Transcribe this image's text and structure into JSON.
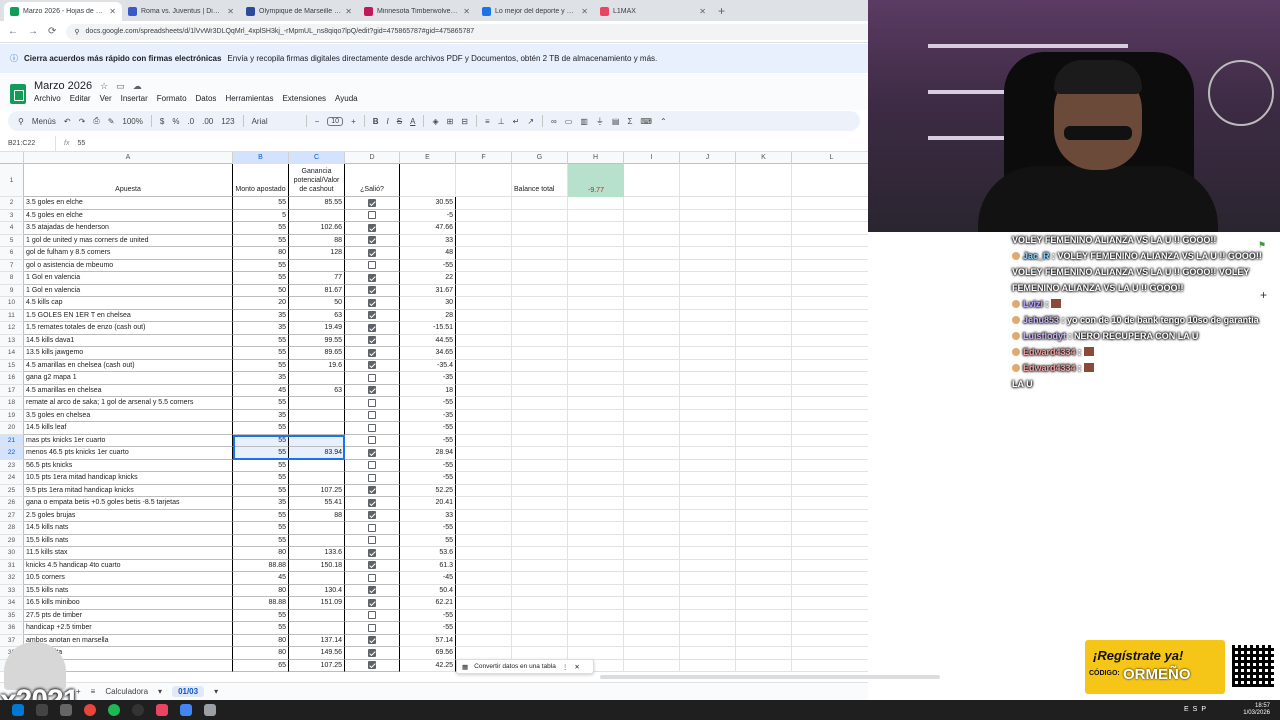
{
  "browser": {
    "tabs": [
      {
        "title": "Marzo 2026 - Hojas de cálculo",
        "color": "#0f9d58"
      },
      {
        "title": "Roma vs. Juventus | Disney+",
        "color": "#3a5bc7"
      },
      {
        "title": "Olympique de Marseille - Olym",
        "color": "#2b4a9a"
      },
      {
        "title": "Minnesota Timberwolves vs Det",
        "color": "#c2185b"
      },
      {
        "title": "Lo mejor del deporte y el entre",
        "color": "#1a73e8"
      },
      {
        "title": "L1MAX",
        "color": "#e94560"
      }
    ],
    "url": "docs.google.com/spreadsheets/d/1lVvWr3DLQqMrl_4xplSH3kj_-rMpmUL_ns8qiqo7lpQ/edit?gid=475865787#gid=475865787"
  },
  "banner": {
    "bold": "Cierra acuerdos más rápido con firmas electrónicas",
    "text": "Envía y recopila firmas digitales directamente desde archivos PDF y Documentos, obtén 2 TB de almacenamiento y más."
  },
  "doc": {
    "title": "Marzo 2026",
    "menus": [
      "Archivo",
      "Editar",
      "Ver",
      "Insertar",
      "Formato",
      "Datos",
      "Herramientas",
      "Extensiones",
      "Ayuda"
    ]
  },
  "toolbar": {
    "search": "Menús",
    "zoom": "100%",
    "currency": "$",
    "percent": "%",
    "dec_minus": ".0",
    "dec_plus": ".00",
    "format123": "123",
    "font": "Arial",
    "font_size": "10"
  },
  "formula_bar": {
    "name_box": "B21:C22",
    "fx": "fx",
    "value": "55"
  },
  "columns": [
    "A",
    "B",
    "C",
    "D",
    "E",
    "F",
    "G",
    "H",
    "I",
    "J",
    "K",
    "L"
  ],
  "header_row": {
    "a": "Apuesta",
    "b": "Monto apostado",
    "c": "Ganancia potencial/Valor de cashout",
    "d": "¿Salió?"
  },
  "balance": {
    "label": "Balance total",
    "value": "-9.77"
  },
  "rows": [
    {
      "n": "2",
      "a": "3.5 goles en elche",
      "b": "55",
      "c": "85.55",
      "d": true,
      "e": "30.55"
    },
    {
      "n": "3",
      "a": "4.5 goles en elche",
      "b": "5",
      "c": "",
      "d": false,
      "e": "-5"
    },
    {
      "n": "4",
      "a": "3.5 atajadas de henderson",
      "b": "55",
      "c": "102.66",
      "d": true,
      "e": "47.66"
    },
    {
      "n": "5",
      "a": "1 gol de united y mas corners de united",
      "b": "55",
      "c": "88",
      "d": true,
      "e": "33"
    },
    {
      "n": "6",
      "a": "gol de fulham y 8.5 corners",
      "b": "80",
      "c": "128",
      "d": true,
      "e": "48"
    },
    {
      "n": "7",
      "a": "gol o asistencia de mbeumo",
      "b": "55",
      "c": "",
      "d": false,
      "e": "-55"
    },
    {
      "n": "8",
      "a": "1 Gol en valencia",
      "b": "55",
      "c": "77",
      "d": true,
      "e": "22"
    },
    {
      "n": "9",
      "a": "1 Gol en valencia",
      "b": "50",
      "c": "81.67",
      "d": true,
      "e": "31.67"
    },
    {
      "n": "10",
      "a": "4.5 kills cap",
      "b": "20",
      "c": "50",
      "d": true,
      "e": "30"
    },
    {
      "n": "11",
      "a": "1.5 GOLES EN 1ER T en chelsea",
      "b": "35",
      "c": "63",
      "d": true,
      "e": "28"
    },
    {
      "n": "12",
      "a": "1.5 remates totales de enzo (cash out)",
      "b": "35",
      "c": "19.49",
      "d": true,
      "e": "-15.51"
    },
    {
      "n": "13",
      "a": "14.5 kills dava1",
      "b": "55",
      "c": "99.55",
      "d": true,
      "e": "44.55"
    },
    {
      "n": "14",
      "a": "13.5 kills jawgemo",
      "b": "55",
      "c": "89.65",
      "d": true,
      "e": "34.65"
    },
    {
      "n": "15",
      "a": "4.5 amarillas en chelsea (cash out)",
      "b": "55",
      "c": "19.6",
      "d": true,
      "e": "-35.4"
    },
    {
      "n": "16",
      "a": "gana g2 mapa 1",
      "b": "35",
      "c": "",
      "d": false,
      "e": "-35"
    },
    {
      "n": "17",
      "a": "4.5 amarillas en chelsea",
      "b": "45",
      "c": "63",
      "d": true,
      "e": "18"
    },
    {
      "n": "18",
      "a": "remate al arco de saka; 1 gol de arsenal y 5.5 corners",
      "b": "55",
      "c": "",
      "d": false,
      "e": "-55"
    },
    {
      "n": "19",
      "a": "3.5 goles en chelsea",
      "b": "35",
      "c": "",
      "d": false,
      "e": "-35"
    },
    {
      "n": "20",
      "a": "14.5 kills leaf",
      "b": "55",
      "c": "",
      "d": false,
      "e": "-55"
    },
    {
      "n": "21",
      "a": "mas pts knicks 1er cuarto",
      "b": "55",
      "c": "",
      "d": false,
      "e": "-55"
    },
    {
      "n": "22",
      "a": "menos 46.5 pts knicks 1er cuarto",
      "b": "55",
      "c": "83.94",
      "d": true,
      "e": "28.94"
    },
    {
      "n": "23",
      "a": "56.5 pts knicks",
      "b": "55",
      "c": "",
      "d": false,
      "e": "-55"
    },
    {
      "n": "24",
      "a": "10.5 pts 1era mitad handicap knicks",
      "b": "55",
      "c": "",
      "d": false,
      "e": "-55"
    },
    {
      "n": "25",
      "a": "9.5 pts 1era mitad handicap knicks",
      "b": "55",
      "c": "107.25",
      "d": true,
      "e": "52.25"
    },
    {
      "n": "26",
      "a": "gana o empata betis +0.5 goles betis -8.5 tarjetas",
      "b": "35",
      "c": "55.41",
      "d": true,
      "e": "20.41"
    },
    {
      "n": "27",
      "a": "2.5 goles brujas",
      "b": "55",
      "c": "88",
      "d": true,
      "e": "33"
    },
    {
      "n": "28",
      "a": "14.5 kills nats",
      "b": "55",
      "c": "",
      "d": false,
      "e": "-55"
    },
    {
      "n": "29",
      "a": "15.5 kills nats",
      "b": "55",
      "c": "",
      "d": false,
      "e": "55"
    },
    {
      "n": "30",
      "a": "11.5 kills stax",
      "b": "80",
      "c": "133.6",
      "d": true,
      "e": "53.6"
    },
    {
      "n": "31",
      "a": "knicks 4.5 handicap 4to cuarto",
      "b": "88.88",
      "c": "150.18",
      "d": true,
      "e": "61.3"
    },
    {
      "n": "32",
      "a": "10.5 corners",
      "b": "45",
      "c": "",
      "d": false,
      "e": "-45"
    },
    {
      "n": "33",
      "a": "15.5 kills nats",
      "b": "80",
      "c": "130.4",
      "d": true,
      "e": "50.4"
    },
    {
      "n": "34",
      "a": "16.5 kills miniboo",
      "b": "88.88",
      "c": "151.09",
      "d": true,
      "e": "62.21"
    },
    {
      "n": "35",
      "a": "27.5 pts de timber",
      "b": "55",
      "c": "",
      "d": false,
      "e": "-55"
    },
    {
      "n": "36",
      "a": "handicap +2.5 timber",
      "b": "55",
      "c": "",
      "d": false,
      "e": "-55"
    },
    {
      "n": "37",
      "a": "ambos anotan en marsella",
      "b": "80",
      "c": "137.14",
      "d": true,
      "e": "57.14"
    },
    {
      "n": "38",
      "a": "tan en celta",
      "b": "80",
      "c": "149.56",
      "d": true,
      "e": "69.56"
    },
    {
      "n": "39",
      "a": "n lyon",
      "b": "65",
      "c": "107.25",
      "d": true,
      "e": "42.25"
    }
  ],
  "toast": {
    "text": "Convertir datos en una tabla"
  },
  "sheet_tabs": {
    "first": "Calculadora",
    "active": "01/03"
  },
  "chat": [
    {
      "user": "",
      "text": "VOLEY FEMENINO ALIANZA VS LA U !! GOOO!!"
    },
    {
      "user": "Jac_R",
      "text": ": VOLEY FEMENINO ALIANZA VS LA U !! GOOO!! VOLEY FEMENINO ALIANZA VS LA U !! GOOO!! VOLEY FEMENINO ALIANZA VS LA U !! GOOO!!"
    },
    {
      "user": "Lvizi",
      "text": ":"
    },
    {
      "user": "Jehu853",
      "text": ": yo con de 10 de bank tengo 10so de garantia"
    },
    {
      "user": "Luisflodyt",
      "text": ": NERO RECUPERA CON LA U"
    },
    {
      "user": "Edward4334",
      "text": ":"
    },
    {
      "user": "Edward4334",
      "text": ":"
    },
    {
      "user": "",
      "text": "LA U"
    }
  ],
  "promo": {
    "line1": "¡Regístrate ya!",
    "code_label": "CÓDIGO:",
    "code": "ORMEÑO"
  },
  "overlay_year": "x2021",
  "taskbar": {
    "tray": "ESP",
    "time": "18:57",
    "date": "1/03/2026"
  }
}
